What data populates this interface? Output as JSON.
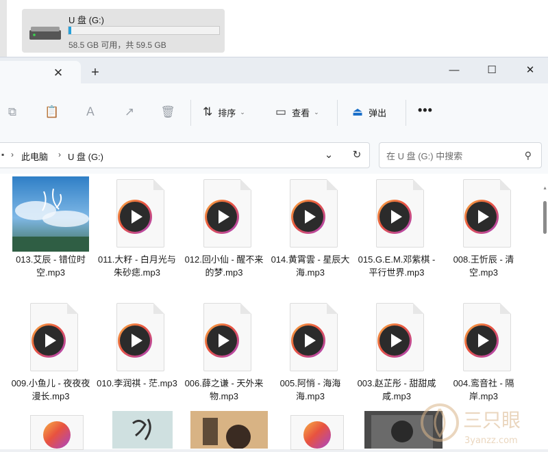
{
  "background_window": {
    "drive": {
      "name": "U 盘 (G:)",
      "free_text": "58.5 GB 可用，共 59.5 GB",
      "used_fraction": 0.017,
      "bar_color": "#26a0da"
    }
  },
  "tab": {
    "close_glyph": "✕",
    "new_glyph": "+"
  },
  "window_controls": {
    "minimize": "—",
    "maximize": "☐",
    "close": "✕"
  },
  "toolbar": {
    "sort_label": "排序",
    "view_label": "查看",
    "eject_label": "弹出",
    "more_label": "•••"
  },
  "address": {
    "crumbs": [
      "此电脑",
      "U 盘 (G:)"
    ],
    "search_placeholder": "在 U 盘 (G:) 中搜索"
  },
  "files": [
    {
      "label": "013.艾辰 - 错位时空.mp3",
      "thumb": "cover-sky"
    },
    {
      "label": "011.大籽 - 白月光与朱砂痣.mp3",
      "thumb": "media"
    },
    {
      "label": "012.回小仙 - 醒不来的梦.mp3",
      "thumb": "media"
    },
    {
      "label": "014.黄霄雲 - 星辰大海.mp3",
      "thumb": "media"
    },
    {
      "label": "015.G.E.M.邓紫棋 - 平行世界.mp3",
      "thumb": "media"
    },
    {
      "label": "008.王忻辰 - 清空.mp3",
      "thumb": "media"
    },
    {
      "label": "009.小鱼儿 - 夜夜夜漫长.mp3",
      "thumb": "media"
    },
    {
      "label": "010.李润祺 - 茫.mp3",
      "thumb": "media"
    },
    {
      "label": "006.薛之谦 - 天外来物.mp3",
      "thumb": "media"
    },
    {
      "label": "005.阿悄 - 海海海.mp3",
      "thumb": "media"
    },
    {
      "label": "003.赵芷彤 - 甜甜咸咸.mp3",
      "thumb": "media"
    },
    {
      "label": "004.鸾音社 - 隔岸.mp3",
      "thumb": "media"
    }
  ],
  "watermark_text": "三只眼",
  "watermark_sub": "3yanzz.com"
}
